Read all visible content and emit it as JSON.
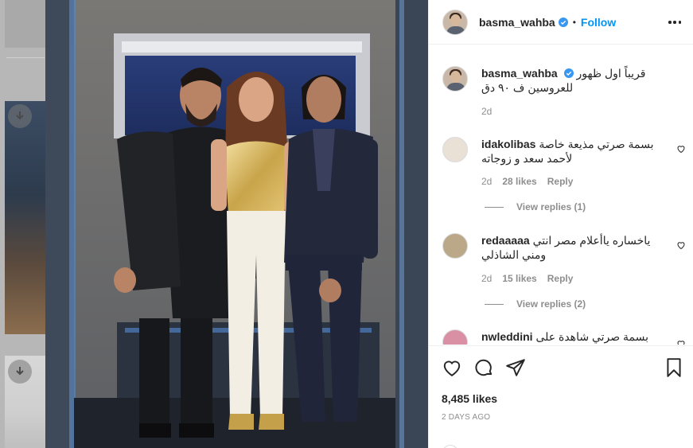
{
  "post": {
    "username": "basma_wahba",
    "follow_label": "Follow",
    "separator": "•",
    "caption_text": "قريباً اول ظهور للعروسين ف ٩٠ دق",
    "caption_age": "2d",
    "likes_text": "8,485 likes",
    "posted_ago": "2 DAYS AGO"
  },
  "comments": [
    {
      "username": "idakolibas",
      "text": "بسمة صرتي مذيعة خاصة لأحمد سعد و زوجاته",
      "age": "2d",
      "likes": "28 likes",
      "reply_label": "Reply",
      "view_replies": "View replies (1)"
    },
    {
      "username": "redaaaaa",
      "text": "ياخساره ياأعلام مصر انتي ومني الشاذلي",
      "age": "2d",
      "likes": "15 likes",
      "reply_label": "Reply",
      "view_replies": "View replies (2)"
    },
    {
      "username": "nwleddini",
      "text": "بسمة صرتي شاهدة على",
      "age": "",
      "likes": "",
      "reply_label": "",
      "view_replies": ""
    }
  ],
  "icons": {
    "more": "more-options-icon",
    "like": "heart-icon",
    "comment": "comment-icon",
    "share": "share-icon",
    "save": "bookmark-icon",
    "download": "download-icon",
    "verified": "verified-badge-icon"
  },
  "colors": {
    "accent": "#0095f6",
    "text": "#262626",
    "muted": "#8e8e8e",
    "border": "#efefef"
  }
}
